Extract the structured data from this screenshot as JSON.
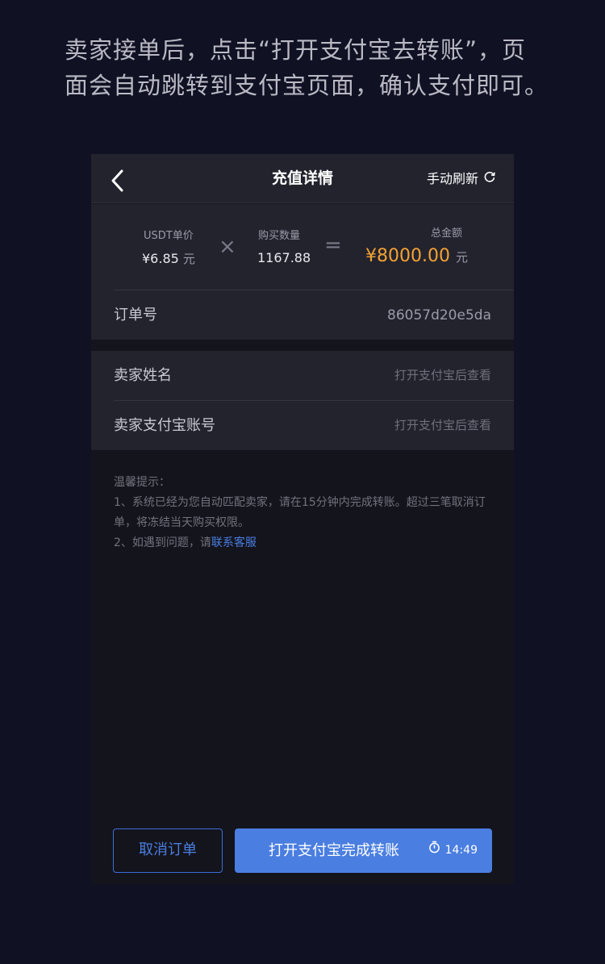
{
  "instruction": "卖家接单后，点击“打开支付宝去转账”，页面会自动跳转到支付宝页面，确认支付即可。",
  "nav": {
    "back_icon": "chevron-left-icon",
    "title": "充值详情",
    "refresh_label": "手动刷新",
    "refresh_icon": "refresh-icon"
  },
  "calc": {
    "unit_price_label": "USDT单价",
    "unit_price_value": "¥6.85",
    "unit": "元",
    "times_symbol": "×",
    "quantity_label": "购买数量",
    "quantity_value": "1167.88",
    "equals_symbol": "=",
    "total_label": "总金额",
    "total_value": "¥8000.00",
    "total_color": "#f3a233"
  },
  "order": {
    "label": "订单号",
    "value": "86057d20e5da"
  },
  "seller": {
    "name_label": "卖家姓名",
    "name_hint": "打开支付宝后查看",
    "account_label": "卖家支付宝账号",
    "account_hint": "打开支付宝后查看"
  },
  "tips": {
    "title": "温馨提示：",
    "line1": "1、系统已经为您自动匹配卖家，请在15分钟内完成转账。超过三笔取消订单，将冻结当天购买权限。",
    "line2_prefix": "2、如遇到问题，请",
    "line2_link": "联系客服",
    "link_color": "#4a7ee0"
  },
  "actions": {
    "cancel_label": "取消订单",
    "pay_label": "打开支付宝完成转账",
    "timer_icon": "stopwatch-icon",
    "timer_value": "14:49",
    "accent_color": "#4a7ee0"
  }
}
